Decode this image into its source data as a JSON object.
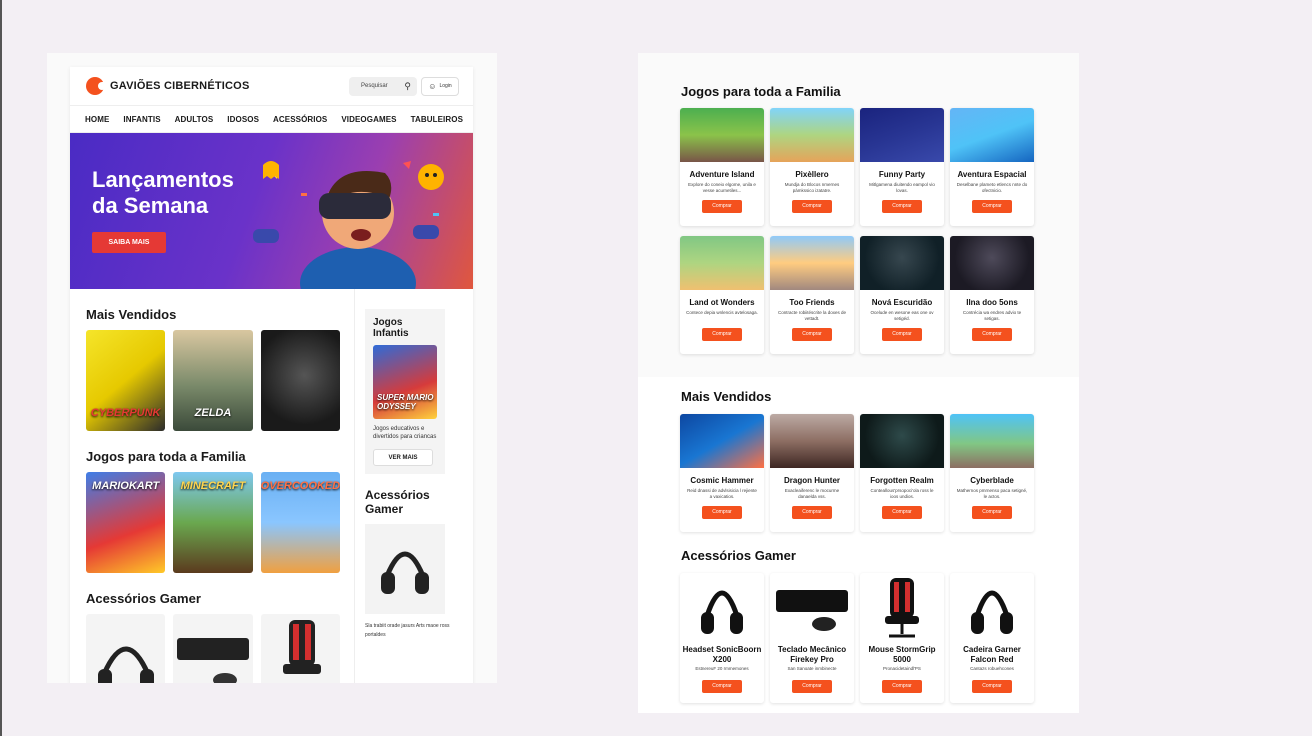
{
  "site": {
    "brand": "GAVIÕES CIBERNÉTICOS",
    "search_placeholder": "Pesquisar",
    "login_label": "Login",
    "nav": [
      "HOME",
      "INFANTIS",
      "ADULTOS",
      "IDOSOS",
      "ACESSÓRIOS",
      "VIDEOGAMES",
      "TABULEIROS"
    ],
    "hero": {
      "title_line1": "Lançamentos",
      "title_line2": "da Semana",
      "button": "SAIBA MAIS"
    },
    "sections": {
      "mais_vendidos": "Mais Vendidos",
      "familia": "Jogos para toda a Familia",
      "acessorios": "Acessórios Gamer"
    },
    "mais_vendidos_tiles": [
      "CYBERPUNK",
      "ZELDA",
      ""
    ],
    "familia_tiles": [
      "MARIOKART",
      "MINECRAFT",
      "OVERCOOKED!"
    ],
    "sidebar": {
      "infantis_title": "Jogos Infantis",
      "infantis_img_label": "SUPER MARIO ODYSSEY",
      "infantis_text": "Jogos educativos e divertidos para criancas",
      "ver_mais": "VER MAIS",
      "acessorios_title": "Acessórios Gamer",
      "acessorios_text": "Sla trabiit orade jasurs Arts maoe ross portaldes"
    }
  },
  "right": {
    "familia_title": "Jogos para toda a Familia",
    "mais_vendidos_title": "Mais Vendidos",
    "acessorios_title": "Acessórios Gamer",
    "buy_label": "Comprar",
    "familia_games": [
      {
        "name": "Adventure Island",
        "desc": "Explore do coneio elgome, unila e vesse acurnetiles..."
      },
      {
        "name": "Pixèllero",
        "desc": "Mundja do Blocos nmernes pàmkssico izatatre."
      },
      {
        "name": "Funny Party",
        "desc": "Mitlgamena diuitendo eampol vio lovas."
      },
      {
        "name": "Aventura Espacial",
        "desc": "Deselbane plameto etlencs nnte do ofectnicio."
      },
      {
        "name": "Land ot Wonders",
        "desc": "Contece depia wnlencis avtelosaga."
      },
      {
        "name": "Too Friends",
        "desc": "Contracte robiitéscrite la doxes de vettadt."
      },
      {
        "name": "Nová Escuridão",
        "desc": "Ocelude en wesone eas one ov setigéd."
      },
      {
        "name": "Ilna doo 5ons",
        "desc": "Contrécia wa endres advio te setigas."
      }
    ],
    "mais_vendidos": [
      {
        "name": "Cosmic Hammer",
        "desc": "Reid dnassi de advlsisicia l rejiente a vaxicatios."
      },
      {
        "name": "Dragon Hunter",
        "desc": "Exacleaiferenc le mocurme danaelda vss."
      },
      {
        "name": "Forgotten Realm",
        "desc": "Conteallous'prsopoci'ola ross le ioos undios."
      },
      {
        "name": "Cyberblade",
        "desc": "Mathernos pmrnenso paca setigné, le actos."
      }
    ],
    "acessorios": [
      {
        "name": "Headset SonicBoorn X200",
        "desc": "EstnereuF 20 rmmemones"
      },
      {
        "name": "Teclado Mecânico Firekey Pro",
        "desc": "San Sanoate inmbinecte"
      },
      {
        "name": "Mouse StormGrip 5000",
        "desc": "Pronacidetaindl'PS"
      },
      {
        "name": "Cadeira Garner Falcon Red",
        "desc": "Cantazs robuehcones"
      }
    ]
  },
  "colors": {
    "accent": "#f4511e",
    "hero_button": "#e53935",
    "hero_gradient_start": "#4a2bc4",
    "hero_gradient_end": "#e0573d",
    "background": "#f3eff4"
  }
}
